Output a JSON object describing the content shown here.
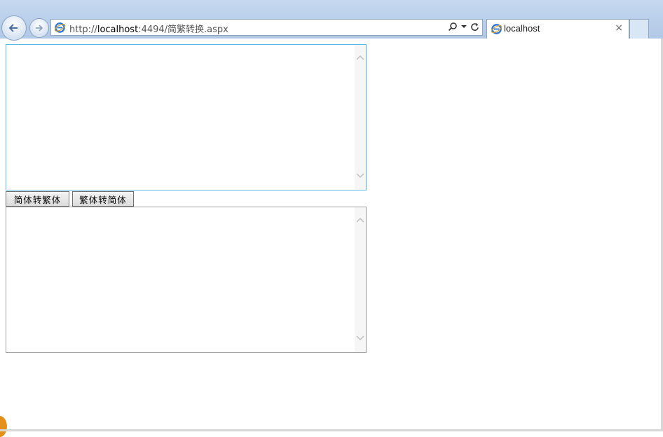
{
  "browser": {
    "address": {
      "prefix": "http://",
      "host": "localhost",
      "rest": ":4494/简繁转换.aspx"
    },
    "tab": {
      "title": "localhost",
      "close_glyph": "×"
    },
    "icons": [
      "back-arrow-icon",
      "forward-arrow-icon",
      "ie-logo-icon",
      "search-icon",
      "dropdown-icon",
      "refresh-icon",
      "close-icon"
    ]
  },
  "page": {
    "source_text": "",
    "result_text": "",
    "buttons": {
      "simp_to_trad": "简体转繁体",
      "trad_to_simp": "繁体转简体"
    }
  },
  "colors": {
    "chrome": "#b9cfea",
    "focus_border": "#5ab8e2",
    "ie_blue": "#2a78d6"
  }
}
